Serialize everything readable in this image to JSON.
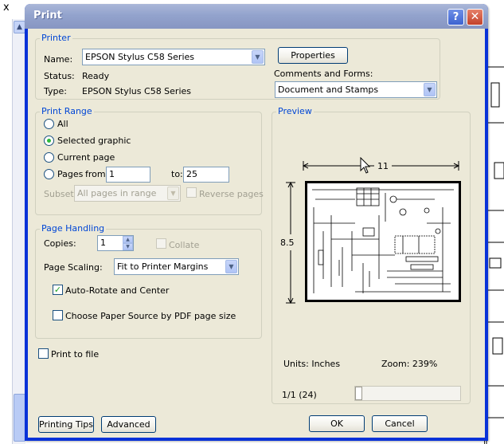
{
  "background": {
    "close_glyph": "x",
    "scroll_up_glyph": "▲"
  },
  "dialog": {
    "title": "Print",
    "help_glyph": "?",
    "close_glyph": "✕"
  },
  "printer": {
    "group_title": "Printer",
    "name_label": "Name:",
    "name_value": "EPSON Stylus C58 Series",
    "properties_button": "Properties",
    "status_label": "Status:",
    "status_value": "Ready",
    "type_label": "Type:",
    "type_value": "EPSON Stylus C58 Series",
    "comments_label": "Comments and Forms:",
    "comments_value": "Document and Stamps"
  },
  "print_range": {
    "group_title": "Print Range",
    "all_label": "All",
    "selected_graphic_label": "Selected graphic",
    "current_page_label": "Current page",
    "pages_label": "Pages",
    "from_label": "from:",
    "from_value": "1",
    "to_label": "to:",
    "to_value": "25",
    "subset_label": "Subset:",
    "subset_value": "All pages in range",
    "reverse_pages_label": "Reverse pages",
    "selected_option": "Selected graphic"
  },
  "page_handling": {
    "group_title": "Page Handling",
    "copies_label": "Copies:",
    "copies_value": "1",
    "collate_label": "Collate",
    "page_scaling_label": "Page Scaling:",
    "page_scaling_value": "Fit to Printer Margins",
    "auto_rotate_label": "Auto-Rotate and Center",
    "auto_rotate_checked": true,
    "paper_source_label": "Choose Paper Source by PDF page size",
    "paper_source_checked": false
  },
  "print_to_file": {
    "label": "Print to file",
    "checked": false
  },
  "preview": {
    "group_title": "Preview",
    "width_dim": "11",
    "height_dim": "8.5",
    "units_label": "Units: Inches",
    "zoom_label": "Zoom: 239%",
    "page_counter": "1/1 (24)",
    "slider_position": 0
  },
  "footer": {
    "printing_tips_button": "Printing Tips",
    "advanced_button": "Advanced",
    "ok_button": "OK",
    "cancel_button": "Cancel"
  },
  "icons": {
    "dropdown": "chevron-down-icon",
    "checkmark": "checkmark-icon",
    "spin_up": "spin-up-icon",
    "spin_down": "spin-down-icon"
  },
  "colors": {
    "group_title": "#0046d5",
    "dialog_bg": "#ece9d8",
    "title_bar": "#93a3cd",
    "radio_dot": "#2dba3c",
    "check_mark": "#21a121"
  }
}
